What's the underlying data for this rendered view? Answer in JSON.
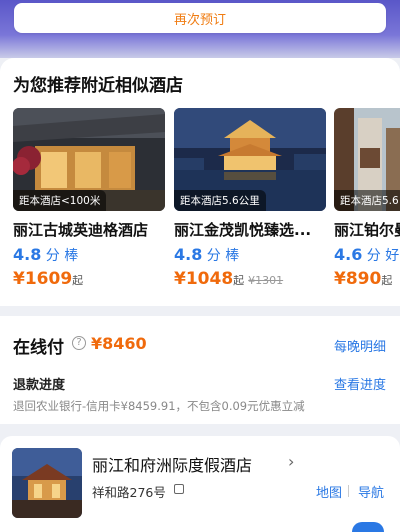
{
  "rebook_label": "再次预订",
  "recommend": {
    "title": "为您推荐附近相似酒店",
    "hotels": [
      {
        "distance": "距本酒店<100米",
        "name": "丽江古城英迪格酒店",
        "score": "4.8",
        "score_unit": "分",
        "score_word": "棒",
        "price": "¥1609",
        "price_suffix": "起",
        "old_price": ""
      },
      {
        "distance": "距本酒店5.6公里",
        "name": "丽江金茂凯悦臻选...",
        "score": "4.8",
        "score_unit": "分",
        "score_word": "棒",
        "price": "¥1048",
        "price_suffix": "起",
        "old_price": "¥1301"
      },
      {
        "distance": "距本酒店5.6",
        "name": "丽江铂尔曼",
        "score": "4.6",
        "score_unit": "分",
        "score_word": "好",
        "price": "¥890",
        "price_suffix": "起",
        "old_price": ""
      }
    ]
  },
  "payment": {
    "label": "在线付",
    "info_icon_glyph": "?",
    "amount": "¥8460",
    "detail_link": "每晚明细",
    "refund_label": "退款进度",
    "refund_link": "查看进度",
    "refund_desc": "退回农业银行-信用卡¥8459.91，不包含0.09元优惠立减"
  },
  "hotel": {
    "name": "丽江和府洲际度假酒店",
    "chevron": "›",
    "address": "祥和路276号",
    "map_link": "地图",
    "nav_link": "导航"
  },
  "colors": {
    "accent": "#2a78e4",
    "price": "#f06a0c",
    "banner": "#5a57c8"
  }
}
